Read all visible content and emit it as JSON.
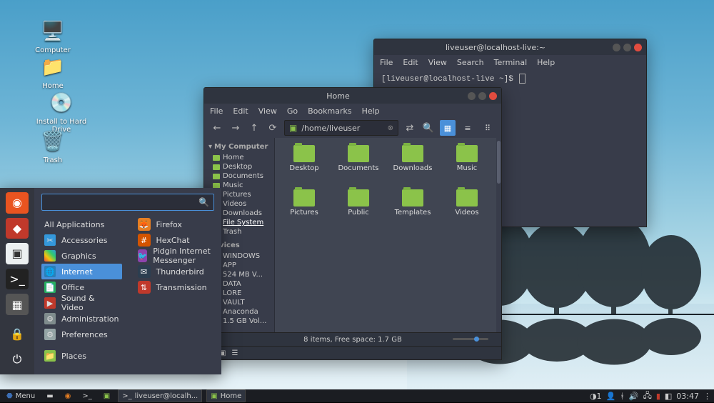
{
  "desktop_icons": [
    {
      "label": "Computer",
      "kind": "computer"
    },
    {
      "label": "Home",
      "kind": "home"
    },
    {
      "label": "Install to Hard Drive",
      "kind": "install"
    },
    {
      "label": "Trash",
      "kind": "trash"
    }
  ],
  "terminal": {
    "title": "liveuser@localhost-live:~",
    "menubar": [
      "File",
      "Edit",
      "View",
      "Search",
      "Terminal",
      "Help"
    ],
    "prompt": "[liveuser@localhost-live ~]$"
  },
  "filemanager": {
    "title": "Home",
    "menubar": [
      "File",
      "Edit",
      "View",
      "Go",
      "Bookmarks",
      "Help"
    ],
    "path": "/home/liveuser",
    "sidebar": {
      "my_computer": "My Computer",
      "places": [
        "Home",
        "Desktop",
        "Documents",
        "Music",
        "Pictures",
        "Videos",
        "Downloads",
        "File System",
        "Trash"
      ],
      "devices_hdr": "Devices",
      "devices": [
        "WINDOWS",
        "APP",
        "524 MB V...",
        "DATA",
        "LORE",
        "VAULT",
        "Anaconda",
        "1.5 GB Vol..."
      ]
    },
    "items": [
      "Desktop",
      "Documents",
      "Downloads",
      "Music",
      "Pictures",
      "Public",
      "Templates",
      "Videos"
    ],
    "status": "8 items, Free space: 1.7 GB"
  },
  "appmenu": {
    "search_placeholder": "",
    "categories": [
      "All Applications",
      "Accessories",
      "Graphics",
      "Internet",
      "Office",
      "Sound & Video",
      "Administration",
      "Preferences",
      "Places"
    ],
    "selected_category": "Internet",
    "apps": [
      "Firefox",
      "HexChat",
      "Pidgin Internet Messenger",
      "Thunderbird",
      "Transmission"
    ]
  },
  "taskbar": {
    "menu_label": "Menu",
    "windows": [
      "liveuser@localh...",
      "Home"
    ],
    "clock": "03:47",
    "workspace_badge": "1"
  },
  "colors": {
    "bg_dark": "#383c4a",
    "accent": "#4a90d9",
    "folder": "#8bc34a",
    "close": "#e24c3f"
  }
}
